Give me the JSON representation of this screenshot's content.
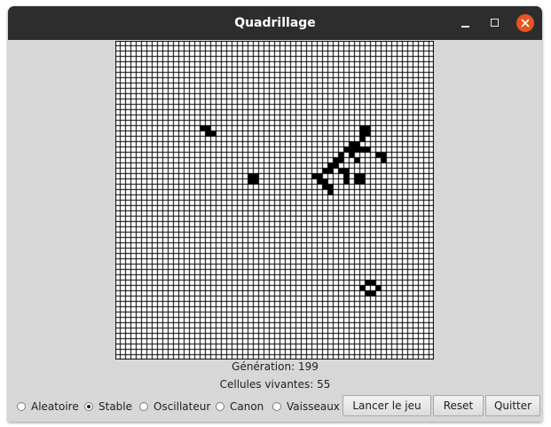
{
  "window": {
    "title": "Quadrillage"
  },
  "grid": {
    "rows": 60,
    "cols": 60,
    "cell_color": "#000000",
    "background": "#ffffff",
    "gridline_color": "#000000",
    "live_cells": [
      [
        16,
        16
      ],
      [
        16,
        17
      ],
      [
        17,
        17
      ],
      [
        17,
        18
      ],
      [
        25,
        25
      ],
      [
        25,
        26
      ],
      [
        26,
        25
      ],
      [
        26,
        26
      ],
      [
        16,
        46
      ],
      [
        16,
        47
      ],
      [
        17,
        46
      ],
      [
        17,
        47
      ],
      [
        18,
        46
      ],
      [
        19,
        44
      ],
      [
        19,
        45
      ],
      [
        20,
        43
      ],
      [
        20,
        44
      ],
      [
        20,
        45
      ],
      [
        20,
        46
      ],
      [
        20,
        47
      ],
      [
        21,
        42
      ],
      [
        21,
        44
      ],
      [
        21,
        49
      ],
      [
        21,
        50
      ],
      [
        22,
        41
      ],
      [
        22,
        42
      ],
      [
        22,
        45
      ],
      [
        22,
        50
      ],
      [
        23,
        40
      ],
      [
        23,
        41
      ],
      [
        24,
        39
      ],
      [
        24,
        40
      ],
      [
        24,
        42
      ],
      [
        24,
        43
      ],
      [
        25,
        37
      ],
      [
        25,
        38
      ],
      [
        25,
        43
      ],
      [
        25,
        45
      ],
      [
        25,
        46
      ],
      [
        26,
        38
      ],
      [
        26,
        39
      ],
      [
        26,
        43
      ],
      [
        26,
        45
      ],
      [
        26,
        46
      ],
      [
        27,
        39
      ],
      [
        27,
        40
      ],
      [
        28,
        40
      ],
      [
        45,
        47
      ],
      [
        45,
        48
      ],
      [
        46,
        46
      ],
      [
        46,
        49
      ],
      [
        47,
        47
      ],
      [
        47,
        48
      ]
    ]
  },
  "status": {
    "generation": "Génération: 199",
    "live_count": "Cellules vivantes: 55"
  },
  "patterns": {
    "options": [
      "Aleatoire",
      "Stable",
      "Oscillateur",
      "Canon",
      "Vaisseaux"
    ],
    "selected": "Stable"
  },
  "buttons": {
    "start": "Lancer le jeu",
    "reset": "Reset",
    "quit": "Quitter"
  },
  "colors": {
    "titlebar": "#2d2d2d",
    "window_bg": "#d7d7d7",
    "close_button": "#e95420"
  }
}
